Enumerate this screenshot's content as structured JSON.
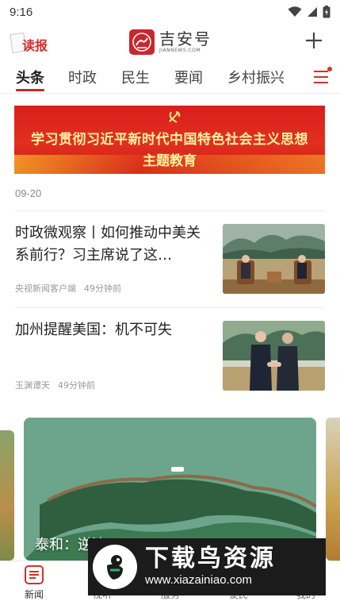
{
  "status_bar": {
    "time": "9:16"
  },
  "header": {
    "read_label": "读报",
    "logo_name": "吉安号",
    "logo_sub": "JIANNEWS.COM"
  },
  "tabs": [
    {
      "label": "头条",
      "active": true
    },
    {
      "label": "时政",
      "active": false
    },
    {
      "label": "民生",
      "active": false
    },
    {
      "label": "要闻",
      "active": false
    },
    {
      "label": "乡村振兴",
      "active": false
    }
  ],
  "banner": {
    "line1": "学习贯彻习近平新时代中国特色社会主义思想",
    "line2": "主题教育"
  },
  "date": "09-20",
  "news": [
    {
      "title": "时政微观察丨如何推动中美关系前行？习主席说了这…",
      "source": "央视新闻客户端",
      "time": "49分钟前"
    },
    {
      "title": "加州提醒美国：机不可失",
      "source": "玉渊谭天",
      "time": "49分钟前"
    }
  ],
  "carousel": {
    "caption": "泰和：逆流… "
  },
  "watermark": {
    "title": "下载鸟资源",
    "url": "www.xiazainiao.com"
  },
  "bottom_nav": [
    {
      "label": "新闻",
      "active": true,
      "icon": "news-icon"
    },
    {
      "label": "视听",
      "active": false,
      "icon": "video-icon"
    },
    {
      "label": "服务",
      "active": false,
      "icon": "service-icon"
    },
    {
      "label": "便民",
      "active": false,
      "icon": "convenience-icon"
    },
    {
      "label": "我的",
      "active": false,
      "icon": "profile-icon"
    }
  ],
  "colors": {
    "brand_red": "#c8272b",
    "banner_text": "#fff3a0"
  }
}
